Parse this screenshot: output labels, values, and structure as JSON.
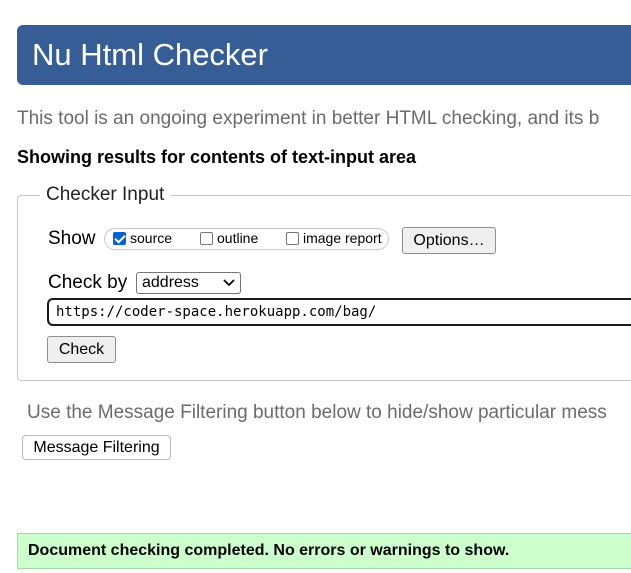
{
  "header": {
    "title": "Nu Html Checker",
    "banner_color": "#365d95"
  },
  "intro_text": "This tool is an ongoing experiment in better HTML checking, and its b",
  "results_heading": "Showing results for contents of text-input area",
  "checker_input": {
    "legend": "Checker Input",
    "show_label": "Show",
    "show_options": [
      {
        "label": "source",
        "checked": true
      },
      {
        "label": "outline",
        "checked": false
      },
      {
        "label": "image report",
        "checked": false
      }
    ],
    "options_button": "Options…",
    "check_by_label": "Check by",
    "check_by_value": "address",
    "url_value": "https://coder-space.herokuapp.com/bag/",
    "check_button": "Check"
  },
  "filtering": {
    "note": "Use the Message Filtering button below to hide/show particular mess",
    "button": "Message Filtering"
  },
  "status": {
    "message": "Document checking completed. No errors or warnings to show.",
    "color": "#ccffcc"
  }
}
